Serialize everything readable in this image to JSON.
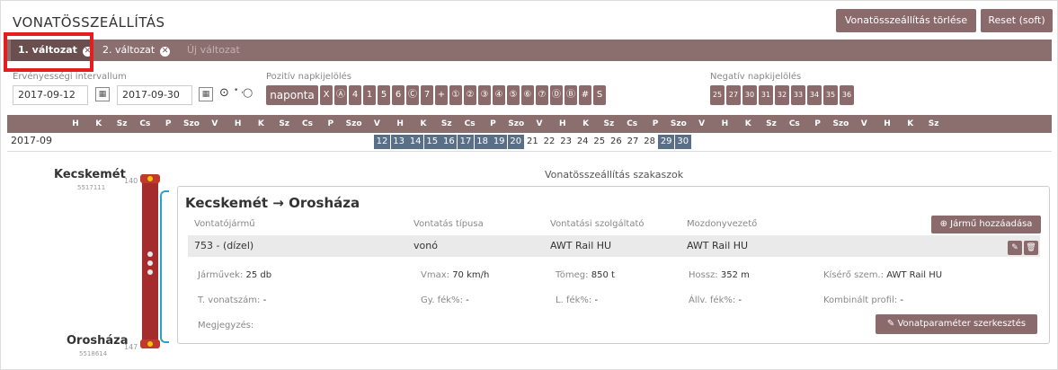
{
  "header": {
    "title": "VONATÖSSZEÁLLÍTÁS",
    "delete_label": "Vonatösszeállítás törlése",
    "reset_label": "Reset (soft)"
  },
  "tabs": [
    {
      "label": "1. változat"
    },
    {
      "label": "2. változat"
    },
    {
      "label": "Új változat"
    }
  ],
  "validity": {
    "label": "Érvényességi intervallum",
    "from": "2017-09-12",
    "to": "2017-09-30",
    "radio_text": "○"
  },
  "positive_marks": {
    "label": "Pozitív napkijelölés",
    "items": [
      "naponta",
      "X",
      "Ⓐ",
      "4",
      "1",
      "5",
      "6",
      "Ⓒ",
      "7",
      "+",
      "①",
      "②",
      "③",
      "④",
      "⑤",
      "⑥",
      "⑦",
      "Ⓓ",
      "Ⓑ",
      "#",
      "S"
    ]
  },
  "negative_marks": {
    "label": "Negatív napkijelölés",
    "items": [
      "25",
      "27",
      "30",
      "31",
      "32",
      "33",
      "34",
      "35",
      "36"
    ]
  },
  "calendar": {
    "month": "2017-09",
    "weekday_labels": [
      "H",
      "K",
      "Sz",
      "Cs",
      "P",
      "Szo",
      "V",
      "H",
      "K",
      "Sz",
      "Cs",
      "P",
      "Szo",
      "V",
      "H",
      "K",
      "Sz",
      "Cs",
      "P",
      "Szo",
      "V",
      "H",
      "K",
      "Sz",
      "Cs",
      "P",
      "Szo",
      "V",
      "H",
      "K",
      "Sz",
      "Cs",
      "P",
      "Szo",
      "V",
      "H",
      "K",
      "Sz"
    ],
    "days": [
      "12",
      "13",
      "14",
      "15",
      "16",
      "17",
      "18",
      "19",
      "20",
      "21",
      "22",
      "23",
      "24",
      "25",
      "26",
      "27",
      "28",
      "29",
      "30"
    ]
  },
  "route": {
    "from_station": "Kecskemét",
    "from_code": "5517111",
    "from_km": "140",
    "to_station": "Orosháza",
    "to_code": "5518614",
    "to_km": "147"
  },
  "section": {
    "heading": "Vonatösszeállítás szakaszok",
    "title": "Kecskemét → Orosháza",
    "add_vehicle_label": "Jármű hozzáadása",
    "columns": {
      "vehicle": "Vontatójármű",
      "type": "Vontatás típusa",
      "provider": "Vontatási szolgáltató",
      "driver": "Mozdonyvezető"
    },
    "row": {
      "vehicle": "753 - (dízel)",
      "type": "vonó",
      "provider": "AWT Rail HU",
      "driver": "AWT Rail HU"
    },
    "params": {
      "vehicles_label": "Járművek:",
      "vehicles_value": "25 db",
      "vmax_label": "Vmax:",
      "vmax_value": "70 km/h",
      "mass_label": "Tömeg:",
      "mass_value": "850 t",
      "length_label": "Hossz:",
      "length_value": "352 m",
      "escort_label": "Kísérő szem.:",
      "escort_value": "AWT Rail HU",
      "train_no_label": "T. vonatszám:",
      "train_no_value": "-",
      "gy_brake_label": "Gy. fék%:",
      "gy_brake_value": "-",
      "l_brake_label": "L. fék%:",
      "l_brake_value": "-",
      "all_brake_label": "Állv. fék%:",
      "all_brake_value": "-",
      "profile_label": "Kombinált profil:",
      "profile_value": "-",
      "note_label": "Megjegyzés:"
    },
    "edit_params_label": "Vonatparaméter szerkesztés"
  },
  "colors": {
    "brand": "#8a6a6a",
    "rail": "#a42c2c",
    "selected_day": "#596f88",
    "highlight": "#e41e1e"
  }
}
